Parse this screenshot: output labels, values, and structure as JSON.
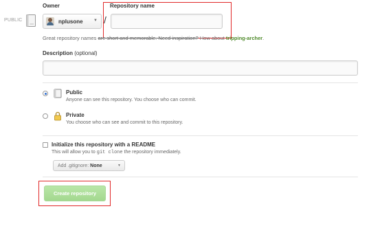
{
  "visibility_badge": "PUBLIC",
  "owner": {
    "heading": "Owner",
    "selected": "nplusone"
  },
  "slash": "/",
  "repository": {
    "heading": "Repository name",
    "value": "",
    "hint_prefix": "Great repository names ",
    "hint_strike": "are short and memorable. Need inspiration?",
    "hint_mid": " How about ",
    "hint_suggestion": "tripping-archer",
    "hint_end": "."
  },
  "description": {
    "label": "Description",
    "optional": " (optional)",
    "value": ""
  },
  "visibility_options": [
    {
      "title": "Public",
      "description": "Anyone can see this repository. You choose who can commit.",
      "icon": "repo-book-icon",
      "checked": true
    },
    {
      "title": "Private",
      "description": "You choose who can see and commit to this repository.",
      "icon": "lock-icon",
      "checked": false
    }
  ],
  "initialize": {
    "title": "Initialize this repository with a README",
    "desc_prefix": "This will allow you to ",
    "desc_code": "git clone",
    "desc_suffix": " the repository immediately.",
    "checked": false
  },
  "gitignore": {
    "label": "Add .gitignore:",
    "value": "None"
  },
  "create_button": "Create repository",
  "colors": {
    "highlight": "#e02828",
    "create_button": "#a3d88f",
    "suggestion": "#4e8a2a"
  }
}
